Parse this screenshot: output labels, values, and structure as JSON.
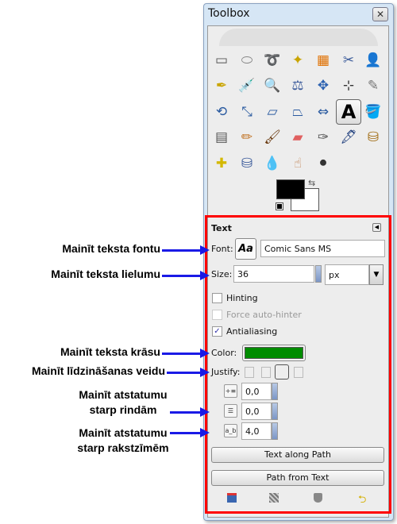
{
  "window": {
    "title": "Toolbox",
    "close_icon": "close-icon"
  },
  "tools": [
    {
      "name": "rect-select",
      "glyph": "▭",
      "color": "#555"
    },
    {
      "name": "ellipse-select",
      "glyph": "⬭",
      "color": "#888"
    },
    {
      "name": "free-select",
      "glyph": "➰",
      "color": "#888"
    },
    {
      "name": "fuzzy-select",
      "glyph": "✦",
      "color": "#c9a400"
    },
    {
      "name": "select-by-color",
      "glyph": "▦",
      "color": "#e07000"
    },
    {
      "name": "scissors",
      "glyph": "✂",
      "color": "#3a5a9a"
    },
    {
      "name": "foreground-select",
      "glyph": "👤",
      "color": "#3a4a8a"
    },
    {
      "name": "paths",
      "glyph": "✒",
      "color": "#c9a400"
    },
    {
      "name": "color-picker",
      "glyph": "💉",
      "color": "#2a5aa0"
    },
    {
      "name": "zoom",
      "glyph": "🔍",
      "color": "#6a8ac0"
    },
    {
      "name": "measure",
      "glyph": "⚖",
      "color": "#3a5a9a"
    },
    {
      "name": "move",
      "glyph": "✥",
      "color": "#2a60b0"
    },
    {
      "name": "align",
      "glyph": "⊹",
      "color": "#333"
    },
    {
      "name": "crop",
      "glyph": "✎",
      "color": "#777"
    },
    {
      "name": "rotate",
      "glyph": "⟲",
      "color": "#2a5aa0"
    },
    {
      "name": "scale",
      "glyph": "⤡",
      "color": "#2a5aa0"
    },
    {
      "name": "shear",
      "glyph": "▱",
      "color": "#2a5aa0"
    },
    {
      "name": "perspective",
      "glyph": "⏢",
      "color": "#2a5aa0"
    },
    {
      "name": "flip",
      "glyph": "⇔",
      "color": "#2a5aa0"
    },
    {
      "name": "text",
      "glyph": "A",
      "color": "#000",
      "active": true
    },
    {
      "name": "bucket-fill",
      "glyph": "🪣",
      "color": "#777"
    },
    {
      "name": "blend",
      "glyph": "▤",
      "color": "#555"
    },
    {
      "name": "pencil",
      "glyph": "✏",
      "color": "#c07020"
    },
    {
      "name": "paintbrush",
      "glyph": "🖌",
      "color": "#6a3a10"
    },
    {
      "name": "eraser",
      "glyph": "▰",
      "color": "#e06060"
    },
    {
      "name": "airbrush",
      "glyph": "✑",
      "color": "#555"
    },
    {
      "name": "ink",
      "glyph": "🖋",
      "color": "#1a3a7a"
    },
    {
      "name": "clone",
      "glyph": "⛁",
      "color": "#a06a10"
    },
    {
      "name": "heal",
      "glyph": "✚",
      "color": "#d4b800"
    },
    {
      "name": "perspective-clone",
      "glyph": "⛁",
      "color": "#3a5a9a"
    },
    {
      "name": "blur",
      "glyph": "💧",
      "color": "#4a80c0"
    },
    {
      "name": "smudge",
      "glyph": "☝",
      "color": "#c08050"
    },
    {
      "name": "dodge-burn",
      "glyph": "⚫",
      "color": "#333"
    }
  ],
  "colors": {
    "foreground": "#000000",
    "background": "#ffffff",
    "swap_icon": "swap-colors-icon",
    "reset_icon": "default-colors-icon"
  },
  "options": {
    "title": "Text",
    "font_label": "Font:",
    "font_preview": "Aa",
    "font_value": "Comic Sans MS",
    "size_label": "Size:",
    "size_value": "36",
    "unit_value": "px",
    "hinting": {
      "label": "Hinting",
      "checked": false
    },
    "autohint": {
      "label": "Force auto-hinter",
      "checked": false,
      "disabled": true
    },
    "antialias": {
      "label": "Antialiasing",
      "checked": true
    },
    "color_label": "Color:",
    "text_color": "#008c00",
    "justify_label": "Justify:",
    "justify_options": [
      "left",
      "right",
      "center",
      "fill"
    ],
    "justify_selected": "center",
    "indent_value": "0,0",
    "line_spacing_value": "0,0",
    "letter_spacing_value": "4,0",
    "text_along_path": "Text along Path",
    "path_from_text": "Path from Text",
    "footer_icons": [
      "save-icon",
      "restore-icon",
      "delete-icon",
      "reset-icon"
    ]
  },
  "annotations": [
    {
      "lines": [
        "Mainīt teksta fontu"
      ]
    },
    {
      "lines": [
        "Mainīt teksta lielumu"
      ]
    },
    {
      "lines": [
        "Mainīt teksta krāsu"
      ]
    },
    {
      "lines": [
        "Mainīt līdzināšanas veidu"
      ]
    },
    {
      "lines": [
        "Mainīt atstatumu",
        "starp rindām"
      ]
    },
    {
      "lines": [
        "Mainīt atstatumu",
        "starp rakstzīmēm"
      ]
    }
  ],
  "accent": {
    "highlight_box": "#ff0000",
    "arrow": "#1a1ae6"
  }
}
